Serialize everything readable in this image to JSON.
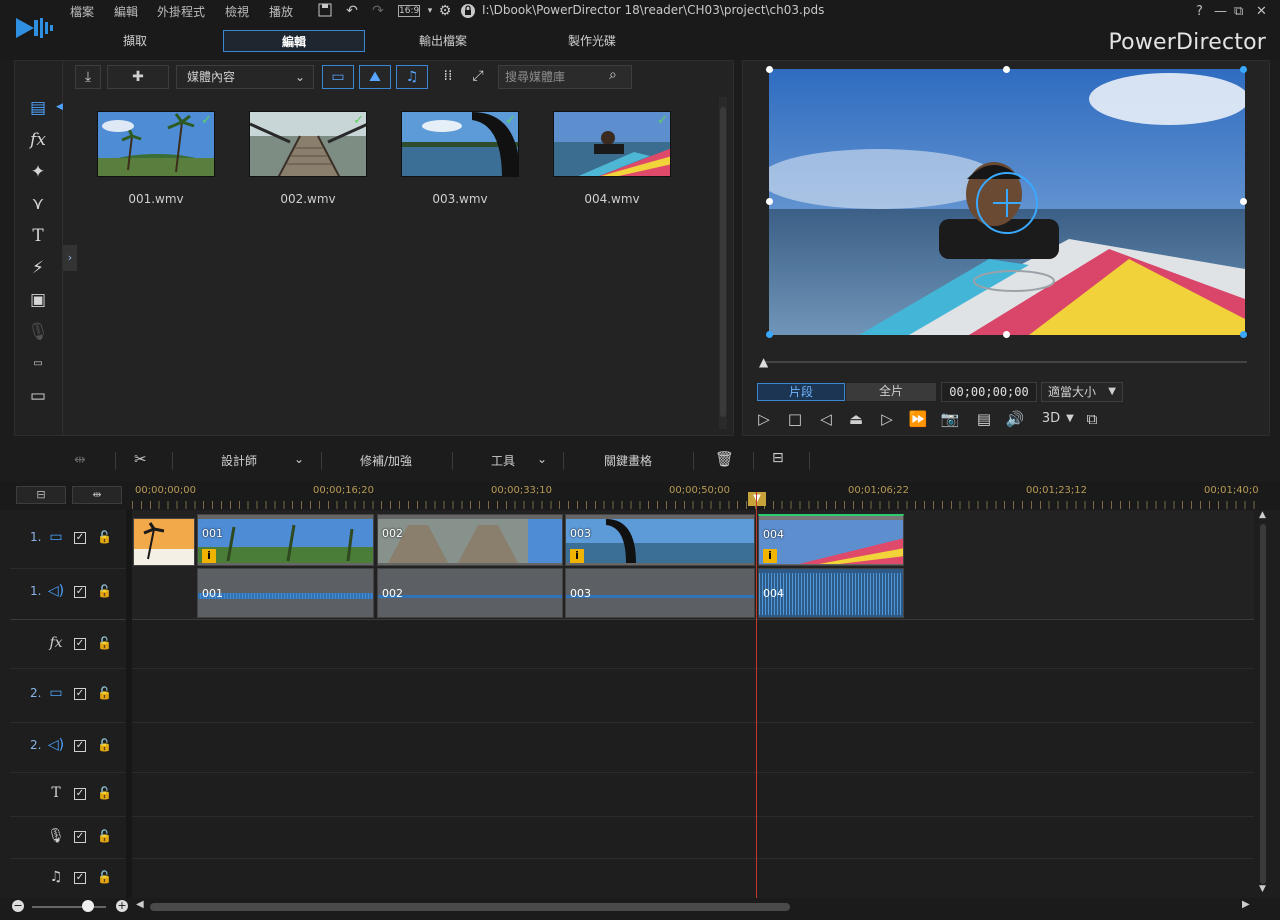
{
  "menubar": {
    "items": [
      "檔案",
      "編輯",
      "外掛程式",
      "檢視",
      "播放"
    ],
    "aspect": "16:9",
    "project_path": "I:\\Dbook\\PowerDirector 18\\reader\\CH03\\project\\ch03.pds",
    "help": "?",
    "brand": "PowerDirector"
  },
  "mode_tabs": [
    "擷取",
    "編輯",
    "輸出檔案",
    "製作光碟"
  ],
  "active_mode": "編輯",
  "library": {
    "filter": "媒體內容",
    "search_placeholder": "搜尋媒體庫",
    "items": [
      {
        "name": "001.wmv"
      },
      {
        "name": "002.wmv"
      },
      {
        "name": "003.wmv"
      },
      {
        "name": "004.wmv"
      }
    ]
  },
  "preview": {
    "tab_clip": "片段",
    "tab_movie": "全片",
    "timecode": "00;00;00;00",
    "fit": "適當大小",
    "stereo": "3D"
  },
  "timeline_toolbar": {
    "designer": "設計師",
    "fix": "修補/加強",
    "tools": "工具",
    "keyframe": "關鍵畫格"
  },
  "ruler": {
    "labels": [
      "00;00;00;00",
      "00;00;16;20",
      "00;00;33;10",
      "00;00;50;00",
      "00;01;06;22",
      "00;01;23;12",
      "00;01;40;0"
    ]
  },
  "tracks": [
    {
      "num": "1.",
      "type": "video"
    },
    {
      "num": "1.",
      "type": "audio"
    },
    {
      "num": "",
      "type": "fx"
    },
    {
      "num": "2.",
      "type": "video"
    },
    {
      "num": "2.",
      "type": "audio"
    },
    {
      "num": "",
      "type": "title"
    },
    {
      "num": "",
      "type": "voice"
    },
    {
      "num": "",
      "type": "music"
    }
  ],
  "clips": {
    "video": [
      "001",
      "002",
      "003",
      "004"
    ],
    "audio": [
      "001",
      "002",
      "003",
      "004"
    ]
  },
  "colors": {
    "accent": "#3a86d1",
    "playhead": "#c0392b",
    "ruler_text": "#b79a55",
    "info_badge": "#f0b400"
  }
}
